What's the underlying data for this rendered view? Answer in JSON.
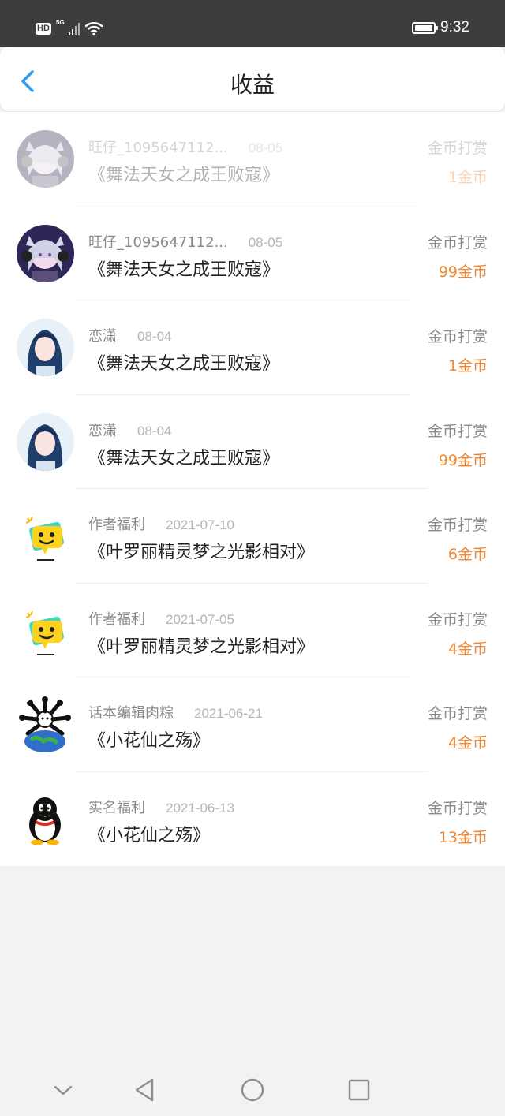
{
  "status_bar": {
    "hd_badge": "HD",
    "network": "5G",
    "time": "9:32"
  },
  "header": {
    "title": "收益",
    "back_icon": "chevron-left-icon"
  },
  "colors": {
    "accent": "#2a9cf0",
    "amount": "#f0862f",
    "status_bar_bg": "#3d3d3d"
  },
  "items": [
    {
      "user": "旺仔_1095647112...",
      "date": "08-05",
      "book": "《舞法天女之成王败寇》",
      "type": "金币打赏",
      "amount": "1金币",
      "faded": true
    },
    {
      "user": "旺仔_1095647112...",
      "date": "08-05",
      "book": "《舞法天女之成王败寇》",
      "type": "金币打赏",
      "amount": "99金币",
      "faded": false
    },
    {
      "user": "恋潇",
      "date": "08-04",
      "book": "《舞法天女之成王败寇》",
      "type": "金币打赏",
      "amount": "1金币",
      "faded": false
    },
    {
      "user": "恋潇",
      "date": "08-04",
      "book": "《舞法天女之成王败寇》",
      "type": "金币打赏",
      "amount": "99金币",
      "faded": false
    },
    {
      "user": "作者福利",
      "date": "2021-07-10",
      "book": "《叶罗丽精灵梦之光影相对》",
      "type": "金币打赏",
      "amount": "6金币",
      "faded": false
    },
    {
      "user": "作者福利",
      "date": "2021-07-05",
      "book": "《叶罗丽精灵梦之光影相对》",
      "type": "金币打赏",
      "amount": "4金币",
      "faded": false
    },
    {
      "user": "话本编辑肉粽",
      "date": "2021-06-21",
      "book": "《小花仙之殇》",
      "type": "金币打赏",
      "amount": "4金币",
      "faded": false
    },
    {
      "user": "实名福利",
      "date": "2021-06-13",
      "book": "《小花仙之殇》",
      "type": "金币打赏",
      "amount": "13金币",
      "faded": false
    }
  ],
  "nav_bar": {
    "icons": [
      "chevron-down-icon",
      "back-triangle-icon",
      "home-circle-icon",
      "recents-square-icon"
    ]
  }
}
